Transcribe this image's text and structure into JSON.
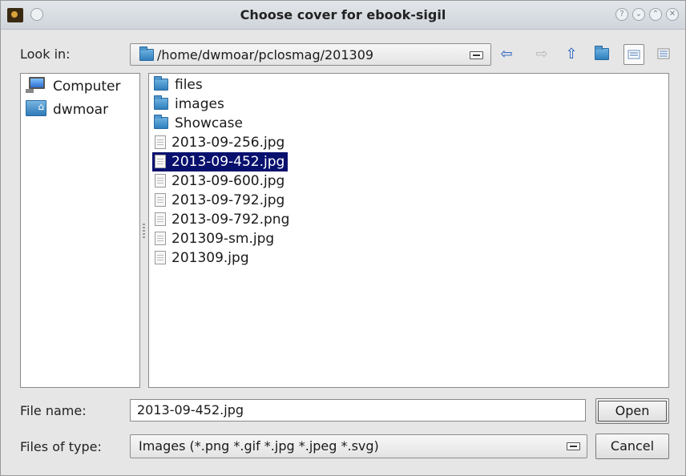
{
  "window": {
    "title": "Choose cover for ebook-sigil"
  },
  "toolbar": {
    "look_in_label": "Look in:",
    "path": "/home/dwmoar/pclosmag/201309"
  },
  "sidebar": {
    "items": [
      {
        "label": "Computer",
        "icon": "computer-icon"
      },
      {
        "label": "dwmoar",
        "icon": "home-folder-icon"
      }
    ]
  },
  "files": {
    "items": [
      {
        "name": "files",
        "type": "folder"
      },
      {
        "name": "images",
        "type": "folder"
      },
      {
        "name": "Showcase",
        "type": "folder"
      },
      {
        "name": "2013-09-256.jpg",
        "type": "file"
      },
      {
        "name": "2013-09-452.jpg",
        "type": "file",
        "selected": true
      },
      {
        "name": "2013-09-600.jpg",
        "type": "file"
      },
      {
        "name": "2013-09-792.jpg",
        "type": "file"
      },
      {
        "name": "2013-09-792.png",
        "type": "file"
      },
      {
        "name": "201309-sm.jpg",
        "type": "file"
      },
      {
        "name": "201309.jpg",
        "type": "file"
      }
    ]
  },
  "footer": {
    "file_name_label": "File name:",
    "file_name_value": "2013-09-452.jpg",
    "file_type_label": "Files of type:",
    "file_type_value": "Images (*.png *.gif *.jpg *.jpeg *.svg)",
    "open_label": "Open",
    "cancel_label": "Cancel"
  },
  "colors": {
    "selection": "#08106e",
    "nav_arrow": "#1f5fbf"
  }
}
